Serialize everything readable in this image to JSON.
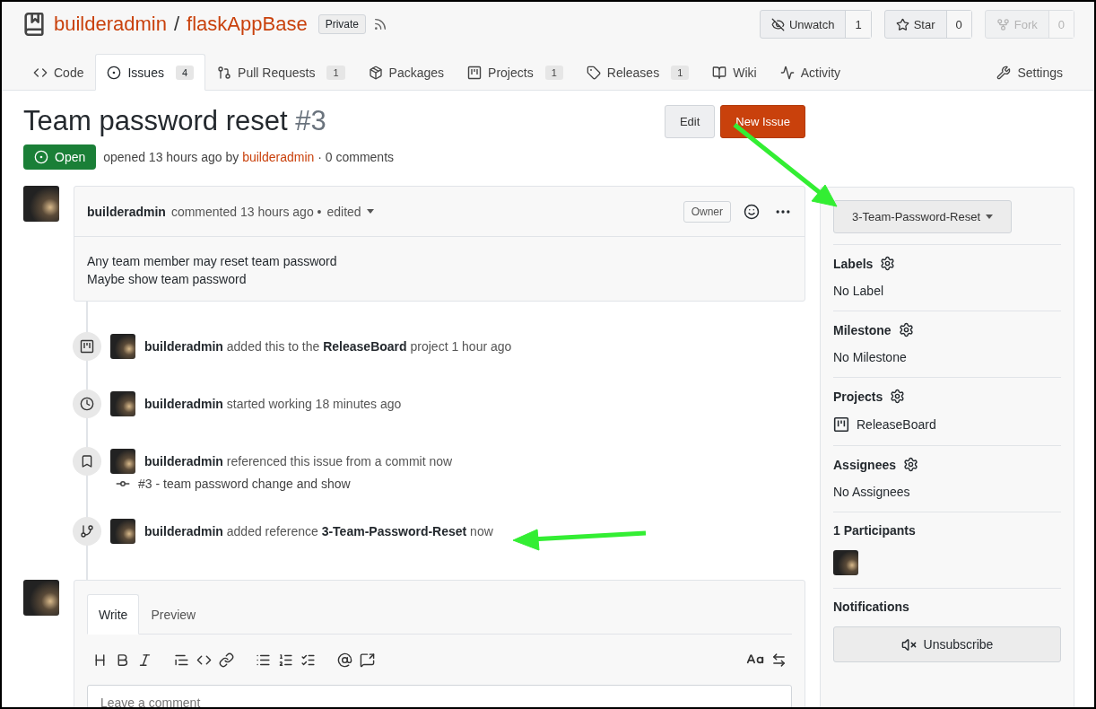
{
  "repo": {
    "owner": "builderadmin",
    "separator": "/",
    "name": "flaskAppBase",
    "visibility": "Private"
  },
  "repo_actions": [
    {
      "kind": "watch",
      "label": "Unwatch",
      "count": "1",
      "disabled": false
    },
    {
      "kind": "star",
      "label": "Star",
      "count": "0",
      "disabled": false
    },
    {
      "kind": "fork",
      "label": "Fork",
      "count": "0",
      "disabled": true
    }
  ],
  "tabs": [
    {
      "kind": "code",
      "label": "Code",
      "selected": false
    },
    {
      "kind": "issues",
      "label": "Issues",
      "count": "4",
      "selected": true
    },
    {
      "kind": "pulls",
      "label": "Pull Requests",
      "count": "1",
      "selected": false
    },
    {
      "kind": "packages",
      "label": "Packages",
      "selected": false
    },
    {
      "kind": "projects",
      "label": "Projects",
      "count": "1",
      "selected": false
    },
    {
      "kind": "releases",
      "label": "Releases",
      "count": "1",
      "selected": false
    },
    {
      "kind": "wiki",
      "label": "Wiki",
      "selected": false
    },
    {
      "kind": "activity",
      "label": "Activity",
      "selected": false
    },
    {
      "kind": "settings",
      "label": "Settings",
      "selected": false
    }
  ],
  "issue": {
    "title": "Team password reset",
    "number": "#3",
    "status": "Open",
    "opened": "opened 13 hours ago by",
    "author": "builderadmin",
    "comments": "· 0 comments"
  },
  "actions": [
    {
      "kind": "secondary",
      "label": "Edit"
    },
    {
      "kind": "primary",
      "label": "New Issue"
    }
  ],
  "comment": {
    "author": "builderadmin",
    "meta": "commented 13 hours ago •",
    "edited": "edited",
    "badge": "Owner",
    "body": [
      "Any team member may reset team password",
      "Maybe show team password"
    ]
  },
  "timeline": [
    {
      "kind": "project",
      "text": "**builderadmin** added this to the **ReleaseBoard** project 1 hour ago"
    },
    {
      "kind": "clock",
      "text": "**builderadmin** started working 18 minutes ago"
    },
    {
      "kind": "bookmark",
      "text": "**builderadmin** referenced this issue from a commit now",
      "commit": "#3 - team password change and show"
    },
    {
      "kind": "branch",
      "text": "**builderadmin** added reference **3-Team-Password-Reset** now"
    }
  ],
  "editor": {
    "tabs": [
      {
        "label": "Write",
        "selected": true
      },
      {
        "label": "Preview",
        "selected": false
      }
    ],
    "placeholder": "Leave a comment"
  },
  "sidebar": {
    "branch": "3-Team-Password-Reset",
    "sections": [
      {
        "kind": "text",
        "title": "Labels",
        "settings": true,
        "value": "No Label"
      },
      {
        "kind": "text",
        "title": "Milestone",
        "settings": true,
        "value": "No Milestone"
      },
      {
        "kind": "project",
        "title": "Projects",
        "settings": true,
        "value": "ReleaseBoard"
      },
      {
        "kind": "text",
        "title": "Assignees",
        "settings": true,
        "value": "No Assignees"
      },
      {
        "kind": "avatars",
        "title": "1 Participants",
        "settings": false
      },
      {
        "kind": "button",
        "title": "Notifications",
        "settings": false,
        "value": "Unsubscribe"
      }
    ]
  }
}
